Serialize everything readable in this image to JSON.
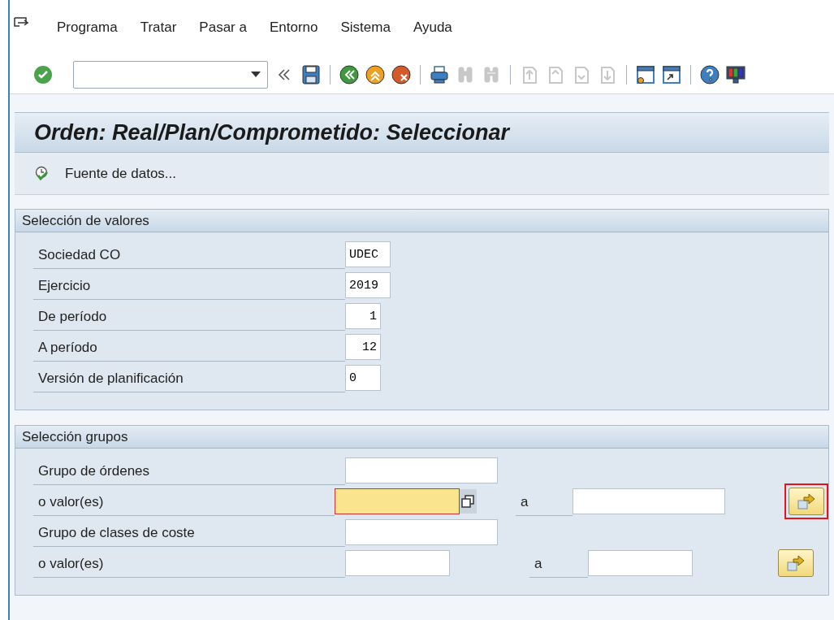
{
  "menu_bar": {
    "items": [
      "Programa",
      "Tratar",
      "Pasar a",
      "Entorno",
      "Sistema",
      "Ayuda"
    ]
  },
  "toolbar": {
    "buttons": [
      {
        "kind": "save",
        "disabled": false
      },
      {
        "kind": "back",
        "disabled": false
      },
      {
        "kind": "exit",
        "disabled": false
      },
      {
        "kind": "cancel",
        "disabled": false
      },
      {
        "kind": "print",
        "disabled": false
      },
      {
        "kind": "find",
        "disabled": true
      },
      {
        "kind": "find_next",
        "disabled": true
      },
      {
        "kind": "first_page",
        "disabled": true
      },
      {
        "kind": "prev_page",
        "disabled": true
      },
      {
        "kind": "next_page",
        "disabled": true
      },
      {
        "kind": "last_page",
        "disabled": true
      },
      {
        "kind": "new_session",
        "disabled": false
      },
      {
        "kind": "shortcut",
        "disabled": false
      },
      {
        "kind": "help",
        "disabled": false
      },
      {
        "kind": "layout",
        "disabled": false
      }
    ]
  },
  "title": "Orden: Real/Plan/Comprometido: Seleccionar",
  "app_toolbar": {
    "buttons": [
      {
        "label": "Fuente de datos..."
      }
    ]
  },
  "sections": [
    {
      "title": "Selección de valores",
      "rows": [
        {
          "label": "Sociedad CO",
          "value": "UDEC"
        },
        {
          "label": "Ejercicio",
          "value": "2019"
        },
        {
          "label": "De período",
          "value": "1"
        },
        {
          "label": "A período",
          "value": "12"
        },
        {
          "label": "Versión de planificación",
          "value": "0"
        }
      ]
    },
    {
      "title": "Selección grupos",
      "rows": [
        {
          "label": "Grupo de órdenes",
          "focused": false
        },
        {
          "label": "o valor(es)",
          "focused": true,
          "to_label": "a",
          "highlighted": true
        },
        {
          "label": "Grupo de clases de coste",
          "focused": false
        },
        {
          "label": "o valor(es)",
          "focused": false,
          "to_label": "a",
          "highlighted": false
        }
      ]
    }
  ]
}
